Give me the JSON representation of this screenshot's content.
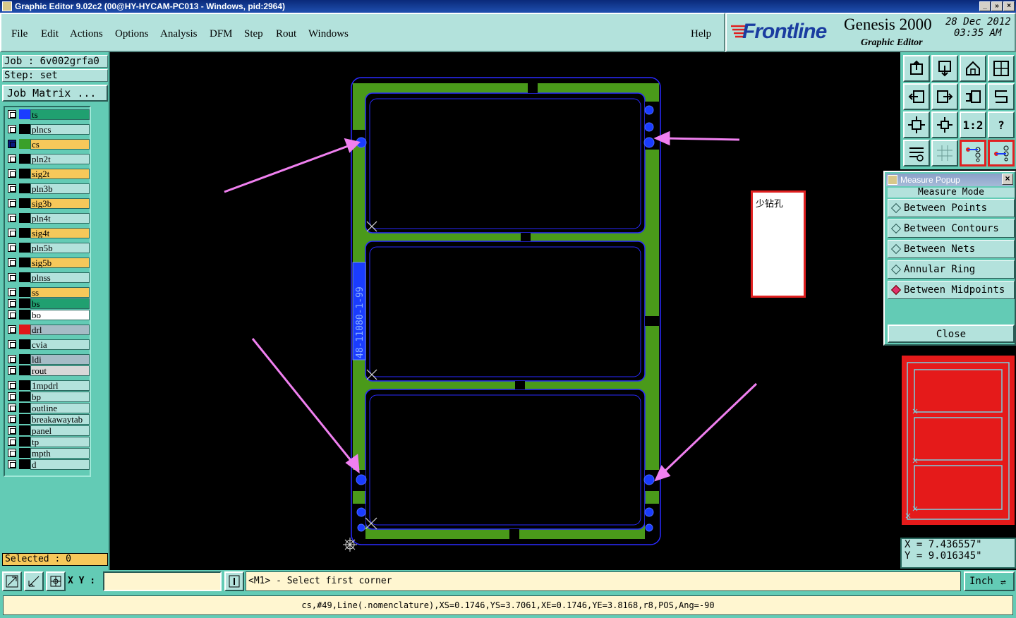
{
  "window": {
    "title": "Graphic Editor 9.02c2 (00@HY-HYCAM-PC013 - Windows, pid:2964)",
    "controls": [
      "_",
      "»",
      "×"
    ]
  },
  "menu": {
    "items": [
      "File",
      "Edit",
      "Actions",
      "Options",
      "Analysis",
      "DFM",
      "Step",
      "Rout",
      "Windows"
    ],
    "help": "Help"
  },
  "brand": {
    "logo": "Frontline",
    "product": "Genesis 2000",
    "subtitle": "Graphic Editor",
    "date": "28 Dec 2012",
    "time": "03:35 AM"
  },
  "job": {
    "job_label": "Job : 6v002grfa0",
    "step_label": "Step: set",
    "matrix_button": "Job Matrix ..."
  },
  "layers": [
    {
      "name": "ts",
      "color": "#20a070",
      "swatch": "#1a3cff"
    },
    {
      "name": "plncs",
      "color": "#b3e2dc",
      "swatch": ""
    },
    {
      "name": "cs",
      "color": "#f6c85a",
      "swatch": "#3aa02a",
      "active": true
    },
    {
      "name": "pln2t",
      "color": "#b3e2dc",
      "swatch": ""
    },
    {
      "name": "sig2t",
      "color": "#f6c85a",
      "swatch": ""
    },
    {
      "name": "pln3b",
      "color": "#b3e2dc",
      "swatch": ""
    },
    {
      "name": "sig3b",
      "color": "#f6c85a",
      "swatch": ""
    },
    {
      "name": "pln4t",
      "color": "#b3e2dc",
      "swatch": ""
    },
    {
      "name": "sig4t",
      "color": "#f6c85a",
      "swatch": ""
    },
    {
      "name": "pln5b",
      "color": "#b3e2dc",
      "swatch": ""
    },
    {
      "name": "sig5b",
      "color": "#f6c85a",
      "swatch": ""
    },
    {
      "name": "plnss",
      "color": "#b3e2dc",
      "swatch": ""
    },
    {
      "name": "ss",
      "color": "#f6c85a",
      "swatch": ""
    },
    {
      "name": "bs",
      "color": "#20a070",
      "swatch": ""
    },
    {
      "name": "bo",
      "color": "#ffffff",
      "swatch": ""
    },
    {
      "name": "drl",
      "color": "#a6bcc6",
      "swatch": "#e01818"
    },
    {
      "name": "cvia",
      "color": "#b3e2dc",
      "swatch": ""
    },
    {
      "name": "ldi",
      "color": "#a6bcc6",
      "swatch": ""
    },
    {
      "name": "rout",
      "color": "#d8d8d8",
      "swatch": ""
    },
    {
      "name": "1mpdrl",
      "color": "#b3e2dc",
      "swatch": ""
    },
    {
      "name": "bp",
      "color": "#b3e2dc",
      "swatch": ""
    },
    {
      "name": "outline",
      "color": "#b3e2dc",
      "swatch": ""
    },
    {
      "name": "breakawaytab",
      "color": "#b3e2dc",
      "swatch": ""
    },
    {
      "name": "panel",
      "color": "#b3e2dc",
      "swatch": ""
    },
    {
      "name": "tp",
      "color": "#b3e2dc",
      "swatch": ""
    },
    {
      "name": "mpth",
      "color": "#b3e2dc",
      "swatch": ""
    },
    {
      "name": "d",
      "color": "#b3e2dc",
      "swatch": ""
    }
  ],
  "selected": "Selected : 0",
  "toolbar_icons": [
    "push-icon",
    "pop-icon",
    "home-icon",
    "window-icon",
    "pan-left-icon",
    "pan-right-icon",
    "undo-zoom-icon",
    "redraw-icon",
    "zoom-fit-icon",
    "zoom-center-icon",
    "one-to-two-icon",
    "help-icon",
    "settings-icon",
    "grid-icon",
    "snap-icon",
    "snap-active-icon"
  ],
  "toolbar_labels": {
    "one_to_two": "1:2",
    "help": "?"
  },
  "measure": {
    "title": "Measure Popup",
    "header": "Measure Mode",
    "options": [
      "Between Points",
      "Between Contours",
      "Between Nets",
      "Annular Ring",
      "Between Midpoints"
    ],
    "selected_index": 4,
    "close": "Close"
  },
  "coords": {
    "x": "X = 7.436557\"",
    "y": "Y = 9.016345\""
  },
  "bottom": {
    "xy_label": "X Y :",
    "xy_value": "",
    "prompt": "<M1> - Select first corner",
    "units": "Inch",
    "status": "cs,#49,Line(.nomenclature),XS=0.1746,YS=3.7061,XE=0.1746,YE=3.8168,r8,POS,Ang=-90"
  },
  "canvas": {
    "annotation_note": "少钻孔",
    "board_text": "48-11080-1-99",
    "colors": {
      "copper": "#4a9a1a",
      "outline": "#2a2aff",
      "arrow": "#f080f0",
      "pad": "#1a3cff"
    }
  }
}
